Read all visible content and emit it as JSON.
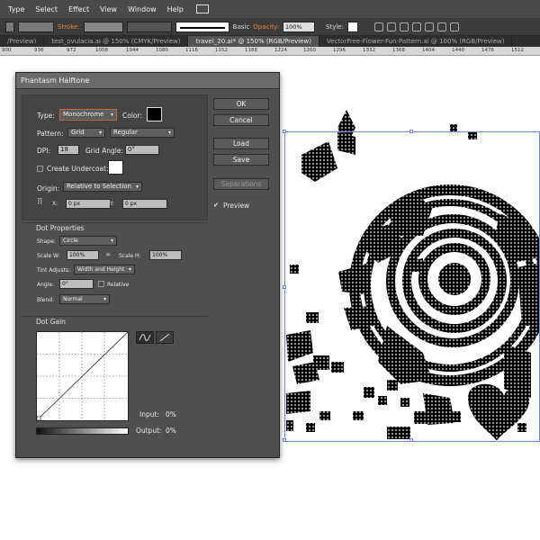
{
  "menu": [
    "Type",
    "Select",
    "Effect",
    "View",
    "Window",
    "Help"
  ],
  "control_bar": {
    "stroke_label": "Stroke:",
    "brush_label": "Basic",
    "opacity_label": "Opacity:",
    "opacity_value": "100%",
    "style_label": "Style:"
  },
  "tabs": [
    {
      "label": "/Preview)",
      "active": false
    },
    {
      "label": "test_ovulacia.ai @ 150% (CMYK/Preview)",
      "active": false
    },
    {
      "label": "travel_20.ai* @ 150% (RGB/Preview)",
      "active": true
    },
    {
      "label": "VectorFree-Flower-Fun-Pattern.ai @ 100% (RGB/Preview)",
      "active": false
    }
  ],
  "ruler": [
    "900",
    "936",
    "972",
    "1008",
    "1044",
    "1080",
    "1116",
    "1152",
    "1188",
    "1224",
    "1260",
    "1296",
    "1332",
    "1368",
    "1404",
    "1440",
    "1476",
    "1512"
  ],
  "dialog": {
    "title": "Phantasm Halftone",
    "type_label": "Type:",
    "type_value": "Monochrome",
    "color_label": "Color:",
    "pattern_label": "Pattern:",
    "pattern_value": "Grid",
    "pattern_style_value": "Regular",
    "dpi_label": "DPI:",
    "dpi_value": "18",
    "grid_angle_label": "Grid Angle:",
    "grid_angle_value": "0°",
    "undercoat_label": "Create Undercoat:",
    "origin_label": "Origin:",
    "origin_value": "Relative to Selection",
    "x_label": "X:",
    "x_value": "0 px",
    "y_label": "Y:",
    "y_value": "0 px",
    "dot_properties_title": "Dot Properties",
    "shape_label": "Shape:",
    "shape_value": "Circle",
    "scale_w_label": "Scale W:",
    "scale_w_value": "100%",
    "scale_h_label": "Scale H:",
    "scale_h_value": "100%",
    "tint_label": "Tint Adjusts:",
    "tint_value": "Width and Height",
    "angle_label": "Angle:",
    "angle_value": "0°",
    "relative_label": "Relative",
    "blend_label": "Blend:",
    "blend_value": "Normal",
    "dot_gain_title": "Dot Gain",
    "input_label": "Input:",
    "input_value": "0%",
    "output_label": "Output:",
    "output_value": "0%",
    "buttons": {
      "ok": "OK",
      "cancel": "Cancel",
      "load": "Load",
      "save": "Save",
      "separations": "Separations"
    },
    "preview_label": "Preview",
    "preview_checked": true
  },
  "colors": {
    "halftone_color": "#000000",
    "undercoat_color": "#ffffff",
    "selection": "#6d8bd6"
  }
}
